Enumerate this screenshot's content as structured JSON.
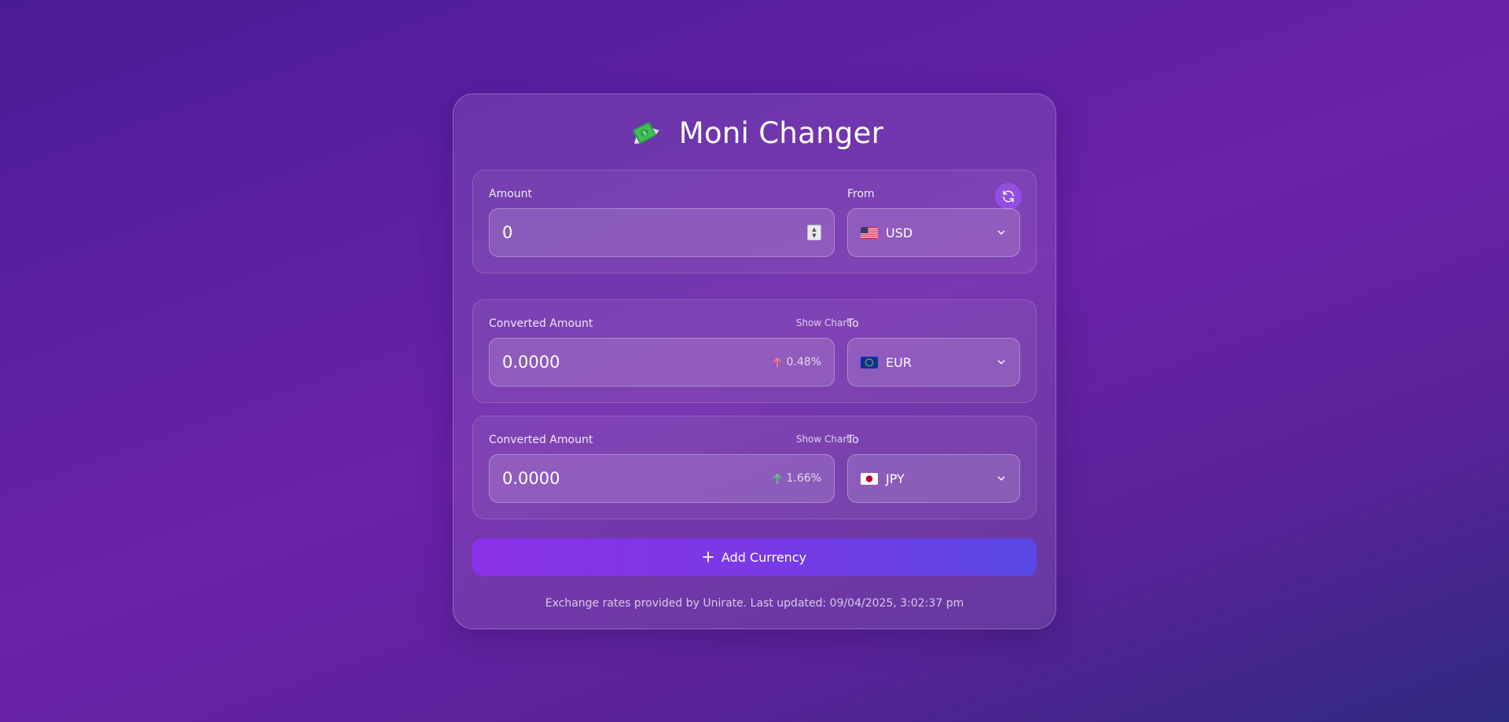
{
  "app": {
    "title": "Moni Changer",
    "logo_icon": "flying-money-icon"
  },
  "source": {
    "amount_label": "Amount",
    "amount_value": "0",
    "from_label": "From",
    "currency": "USD",
    "flag": "us-flag-icon"
  },
  "targets": [
    {
      "label": "Converted Amount",
      "show_chart": "Show Chart",
      "to_label": "To",
      "value": "0.0000",
      "change": "0.48%",
      "change_direction": "up",
      "change_color": "#f07a7a",
      "currency": "EUR",
      "flag": "eu-flag-icon"
    },
    {
      "label": "Converted Amount",
      "show_chart": "Show Chart",
      "to_label": "To",
      "value": "0.0000",
      "change": "1.66%",
      "change_direction": "up",
      "change_color": "#4fd17a",
      "currency": "JPY",
      "flag": "jp-flag-icon"
    }
  ],
  "actions": {
    "add_currency": "Add Currency",
    "swap_icon": "refresh-icon"
  },
  "footer": {
    "text": "Exchange rates provided by Unirate. Last updated: 09/04/2025, 3:02:37 pm"
  },
  "colors": {
    "accent_start": "#8b32e8",
    "accent_end": "#5848e4",
    "swap_button": "#9650e6"
  }
}
